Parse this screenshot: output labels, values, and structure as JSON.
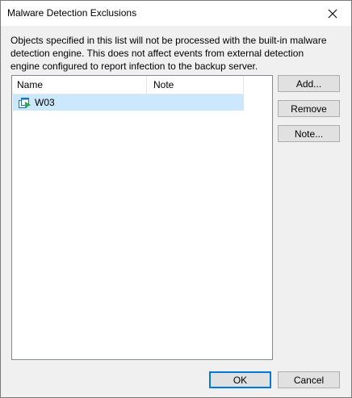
{
  "window": {
    "title": "Malware Detection Exclusions"
  },
  "description": "Objects specified in this list will not be processed with the built-in malware detection engine. This does not affect events from external detection engine configured to report infection to the backup server.",
  "list": {
    "columns": [
      "Name",
      "Note"
    ],
    "rows": [
      {
        "name": "W03",
        "note": "",
        "icon": "vm-icon"
      }
    ]
  },
  "side_buttons": {
    "add": "Add...",
    "remove": "Remove",
    "note": "Note..."
  },
  "footer_buttons": {
    "ok": "OK",
    "cancel": "Cancel"
  },
  "colors": {
    "selection": "#cce8ff",
    "default_button_border": "#0078d7",
    "vm_icon_blue": "#1e6fb8",
    "vm_icon_green": "#2fa84f"
  }
}
